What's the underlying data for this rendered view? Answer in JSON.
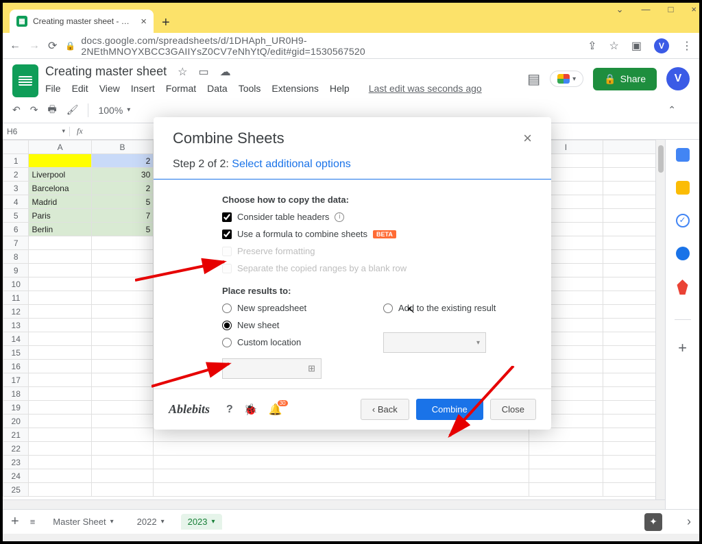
{
  "browser": {
    "tab_title": "Creating master sheet - Google S",
    "url": "docs.google.com/spreadsheets/d/1DHAph_UR0H9-2NEthMNOYXBCC3GAIIYsZ0CV7eNhYtQ/edit#gid=1530567520",
    "avatar_letter": "V"
  },
  "doc": {
    "title": "Creating master sheet",
    "menus": [
      "File",
      "Edit",
      "View",
      "Insert",
      "Format",
      "Data",
      "Tools",
      "Extensions",
      "Help"
    ],
    "last_edit": "Last edit was seconds ago",
    "share": "Share",
    "avatar_letter": "V",
    "zoom": "100%",
    "name_box": "H6"
  },
  "grid": {
    "cols": [
      "A",
      "B",
      "I"
    ],
    "rows": [
      {
        "n": 1,
        "a": "",
        "b": "2"
      },
      {
        "n": 2,
        "a": "Liverpool",
        "b": "30"
      },
      {
        "n": 3,
        "a": "Barcelona",
        "b": "2"
      },
      {
        "n": 4,
        "a": "Madrid",
        "b": "5"
      },
      {
        "n": 5,
        "a": "Paris",
        "b": "7"
      },
      {
        "n": 6,
        "a": "Berlin",
        "b": "5"
      }
    ],
    "extra_row_start": 7,
    "extra_row_end": 25
  },
  "sheet_tabs": {
    "items": [
      "Master Sheet",
      "2022",
      "2023"
    ],
    "active": "2023"
  },
  "modal": {
    "title": "Combine Sheets",
    "step_prefix": "Step 2 of 2: ",
    "step_link": "Select additional options",
    "section1": "Choose how to copy the data:",
    "opt_headers": "Consider table headers",
    "opt_formula": "Use a formula to combine sheets",
    "beta": "BETA",
    "opt_preserve": "Preserve formatting",
    "opt_separate": "Separate the copied ranges by a blank row",
    "section2": "Place results to:",
    "radio_new_spreadsheet": "New spreadsheet",
    "radio_new_sheet": "New sheet",
    "radio_custom": "Custom location",
    "radio_add_existing": "Add to the existing result",
    "brand": "Ablebits",
    "help": "?",
    "badge": "30",
    "btn_back": "‹ Back",
    "btn_combine": "Combine",
    "btn_close": "Close"
  }
}
